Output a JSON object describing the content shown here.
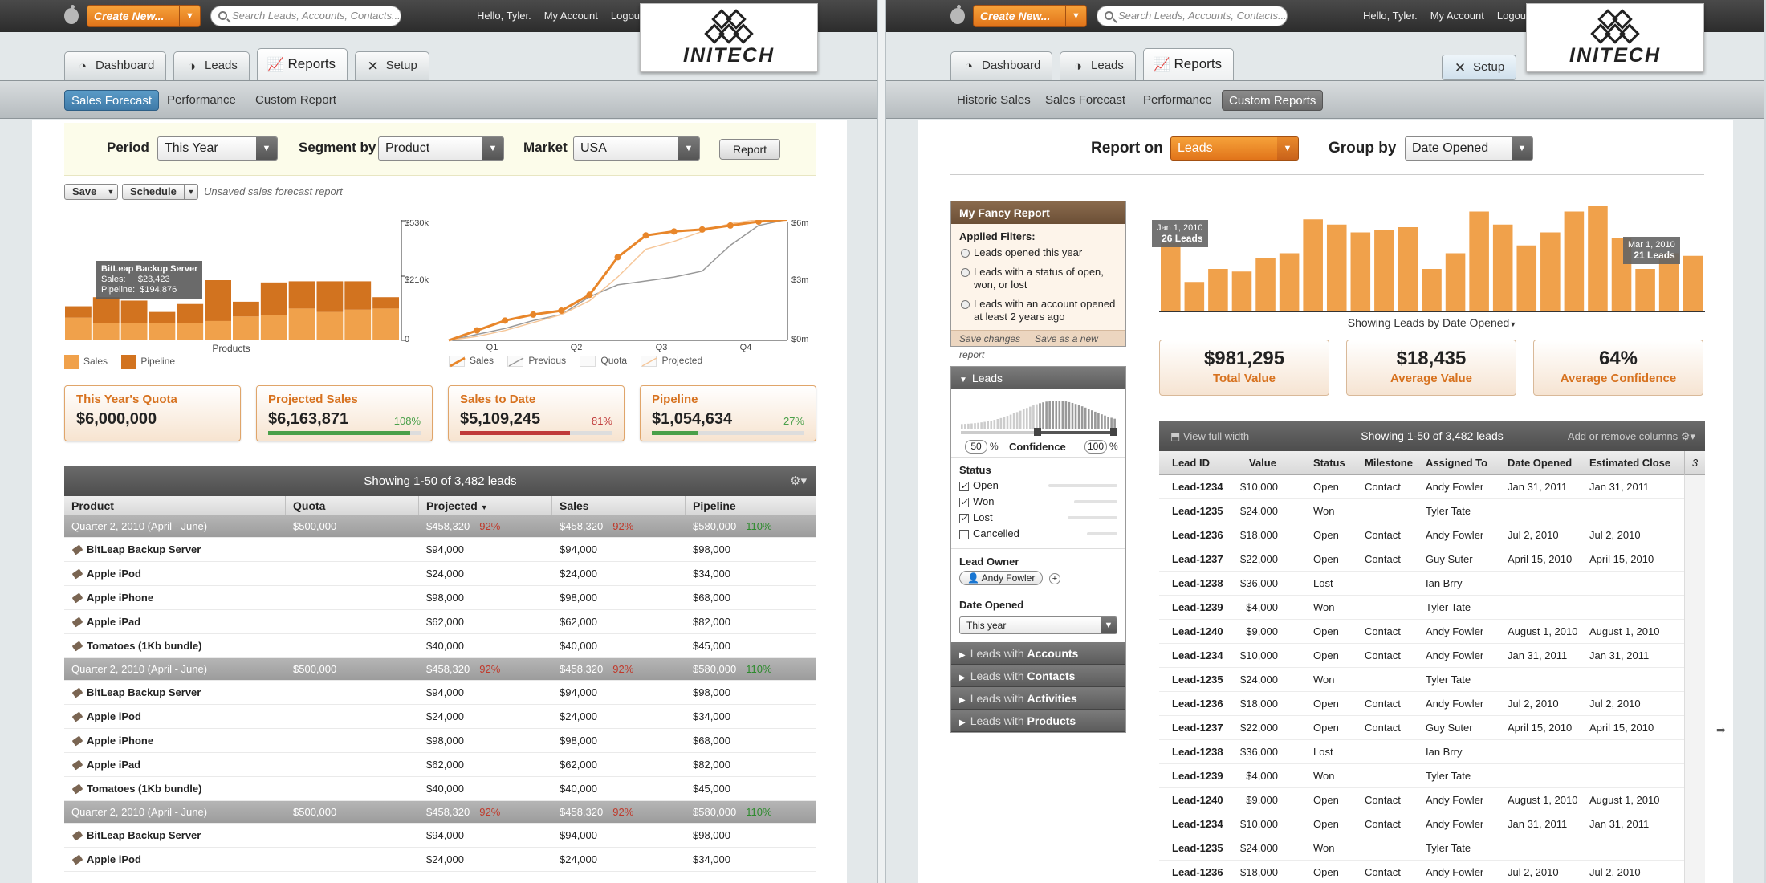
{
  "common": {
    "create_label": "Create New...",
    "search_placeholder": "Search Leads, Accounts, Contacts...",
    "greeting": "Hello, Tyler.",
    "my_account": "My Account",
    "logout": "Logout",
    "logo_text": "INITECH",
    "tabs": [
      "Dashboard",
      "Leads",
      "Reports",
      "Setup"
    ]
  },
  "left": {
    "subnav": [
      "Sales Forecast",
      "Performance",
      "Custom Report"
    ],
    "filters": {
      "period_label": "Period",
      "period_value": "This Year",
      "segment_label": "Segment by",
      "segment_value": "Product",
      "market_label": "Market",
      "market_value": "USA",
      "report_button": "Report"
    },
    "save_label": "Save",
    "schedule_label": "Schedule",
    "unsaved_note": "Unsaved sales forecast report",
    "bar_axis": [
      "$530k",
      "$210k",
      "0"
    ],
    "bar_xlabel": "Products",
    "tooltip": {
      "title": "BitLeap Backup Server",
      "sales": "Sales:     $23,423",
      "pipeline": "Pipeline:  $194,876"
    },
    "line_axis": [
      "$6m",
      "$3m",
      "$0m"
    ],
    "line_quarters": [
      "Q1",
      "Q2",
      "Q3",
      "Q4"
    ],
    "legend_bar": [
      "Sales",
      "Pipeline"
    ],
    "legend_line": [
      "Sales",
      "Previous",
      "Quota",
      "Projected"
    ],
    "cards": [
      {
        "title": "This Year's Quota",
        "value": "$6,000,000",
        "pct": "",
        "fill": 0,
        "color": ""
      },
      {
        "title": "Projected Sales",
        "value": "$6,163,871",
        "pct": "108%",
        "fill": 0.93,
        "color": "#4aa04a"
      },
      {
        "title": "Sales to Date",
        "value": "$5,109,245",
        "pct": "81%",
        "fill": 0.72,
        "color": "#c03a3a"
      },
      {
        "title": "Pipeline",
        "value": "$1,054,634",
        "pct": "27%",
        "fill": 0.3,
        "color": "#4aa04a"
      }
    ],
    "table_title": "Showing 1-50 of 3,482 leads",
    "columns": [
      "Product",
      "Quota",
      "Projected",
      "Sales",
      "Pipeline"
    ],
    "group": {
      "name": "Quarter 2, 2010 (April - June)",
      "quota": "$500,000",
      "projected": "$458,320",
      "projected_pct": "92%",
      "sales": "$458,320",
      "sales_pct": "92%",
      "pipeline": "$580,000",
      "pipeline_pct": "110%"
    },
    "products": [
      {
        "name": "BitLeap Backup Server",
        "projected": "$94,000",
        "sales": "$94,000",
        "pipeline": "$98,000"
      },
      {
        "name": "Apple iPod",
        "projected": "$24,000",
        "sales": "$24,000",
        "pipeline": "$34,000"
      },
      {
        "name": "Apple iPhone",
        "projected": "$98,000",
        "sales": "$98,000",
        "pipeline": "$68,000"
      },
      {
        "name": "Apple iPad",
        "projected": "$62,000",
        "sales": "$62,000",
        "pipeline": "$82,000"
      },
      {
        "name": "Tomatoes (1Kb bundle)",
        "projected": "$40,000",
        "sales": "$40,000",
        "pipeline": "$45,000"
      }
    ]
  },
  "right": {
    "subnav": [
      "Historic Sales",
      "Sales Forecast",
      "Performance",
      "Custom Reports"
    ],
    "report_on_label": "Report on",
    "report_on_value": "Leads",
    "group_by_label": "Group by",
    "group_by_value": "Date Opened",
    "saved": {
      "title": "My Fancy Report",
      "applied": "Applied Filters:",
      "filters": [
        "Leads opened this year",
        "Leads with a status of open, won, or lost",
        "Leads with an account opened at least 2 years ago"
      ],
      "save_changes": "Save changes",
      "save_new": "Save as a new report"
    },
    "leads_panel": {
      "title": "Leads",
      "conf_min": "50",
      "conf_max": "100",
      "conf_label": "Confidence",
      "pct": "%",
      "status_label": "Status",
      "statuses": [
        "Open",
        "Won",
        "Lost",
        "Cancelled"
      ],
      "owner_label": "Lead Owner",
      "owner": "Andy Fowler",
      "date_label": "Date Opened",
      "date_value": "This year"
    },
    "with_panels": [
      {
        "pre": "Leads with ",
        "name": "Accounts"
      },
      {
        "pre": "Leads with ",
        "name": "Contacts"
      },
      {
        "pre": "Leads with ",
        "name": "Activities"
      },
      {
        "pre": "Leads with ",
        "name": "Products"
      }
    ],
    "tip1": {
      "date": "Jan 1, 2010",
      "count": "26 Leads"
    },
    "tip2": {
      "date": "Mar 1, 2010",
      "count": "21 Leads"
    },
    "chart_caption": "Showing Leads by Date Opened",
    "kpis": [
      {
        "value": "$981,295",
        "label": "Total Value"
      },
      {
        "value": "$18,435",
        "label": "Average Value"
      },
      {
        "value": "64%",
        "label": "Average Confidence"
      }
    ],
    "table": {
      "view_full": "View full width",
      "title": "Showing 1-50 of 3,482 leads",
      "add_remove": "Add or remove columns",
      "col_count": "3"
    },
    "columns": [
      "Lead ID",
      "Value",
      "Status",
      "Milestone",
      "Assigned To",
      "Date Opened",
      "Estimated Close"
    ],
    "rows": [
      [
        "Lead-1234",
        "$10,000",
        "Open",
        "Contact",
        "Andy Fowler",
        "Jan 31, 2011",
        "Jan 31, 2011"
      ],
      [
        "Lead-1235",
        "$24,000",
        "Won",
        "",
        "Tyler Tate",
        "",
        ""
      ],
      [
        "Lead-1236",
        "$18,000",
        "Open",
        "Contact",
        "Andy Fowler",
        "Jul 2, 2010",
        "Jul 2, 2010"
      ],
      [
        "Lead-1237",
        "$22,000",
        "Open",
        "Contact",
        "Guy Suter",
        "April 15, 2010",
        "April 15, 2010"
      ],
      [
        "Lead-1238",
        "$36,000",
        "Lost",
        "",
        "Ian Brry",
        "",
        ""
      ],
      [
        "Lead-1239",
        "$4,000",
        "Won",
        "",
        "Tyler Tate",
        "",
        ""
      ],
      [
        "Lead-1240",
        "$9,000",
        "Open",
        "Contact",
        "Andy Fowler",
        "August 1, 2010",
        "August 1, 2010"
      ],
      [
        "Lead-1234",
        "$10,000",
        "Open",
        "Contact",
        "Andy Fowler",
        "Jan 31, 2011",
        "Jan 31, 2011"
      ],
      [
        "Lead-1235",
        "$24,000",
        "Won",
        "",
        "Tyler Tate",
        "",
        ""
      ],
      [
        "Lead-1236",
        "$18,000",
        "Open",
        "Contact",
        "Andy Fowler",
        "Jul 2, 2010",
        "Jul 2, 2010"
      ],
      [
        "Lead-1237",
        "$22,000",
        "Open",
        "Contact",
        "Guy Suter",
        "April 15, 2010",
        "April 15, 2010"
      ],
      [
        "Lead-1238",
        "$36,000",
        "Lost",
        "",
        "Ian Brry",
        "",
        ""
      ],
      [
        "Lead-1239",
        "$4,000",
        "Won",
        "",
        "Tyler Tate",
        "",
        ""
      ],
      [
        "Lead-1240",
        "$9,000",
        "Open",
        "Contact",
        "Andy Fowler",
        "August 1, 2010",
        "August 1, 2010"
      ],
      [
        "Lead-1234",
        "$10,000",
        "Open",
        "Contact",
        "Andy Fowler",
        "Jan 31, 2011",
        "Jan 31, 2011"
      ],
      [
        "Lead-1235",
        "$24,000",
        "Won",
        "",
        "Tyler Tate",
        "",
        ""
      ],
      [
        "Lead-1236",
        "$18,000",
        "Open",
        "Contact",
        "Andy Fowler",
        "Jul 2, 2010",
        "Jul 2, 2010"
      ]
    ]
  },
  "chart_data": [
    {
      "type": "bar",
      "title": "",
      "xlabel": "Products",
      "ylabel": "",
      "ylim": [
        0,
        530000
      ],
      "yticks": [
        "0",
        "$210k",
        "$530k"
      ],
      "series": [
        {
          "name": "Sales",
          "values": [
            200000,
            150000,
            150000,
            150000,
            150000,
            170000,
            210000,
            220000,
            280000,
            250000,
            270000,
            280000
          ]
        },
        {
          "name": "Pipeline",
          "values": [
            100000,
            230000,
            200000,
            100000,
            170000,
            360000,
            130000,
            290000,
            240000,
            270000,
            250000,
            100000
          ]
        }
      ]
    },
    {
      "type": "line",
      "title": "",
      "xlabel": "",
      "ylabel": "",
      "ylim": [
        0,
        6
      ],
      "yticks": [
        "$0m",
        "$3m",
        "$6m"
      ],
      "x": [
        "",
        "Q1",
        "",
        "",
        "Q2",
        "",
        "",
        "Q3",
        "",
        "",
        "Q4",
        "",
        ""
      ],
      "series": [
        {
          "name": "Sales",
          "values": [
            0,
            0.5,
            1.0,
            1.3,
            1.5,
            2.3,
            4.2,
            5.3,
            5.5,
            5.6,
            5.8,
            6.0,
            6.1
          ]
        },
        {
          "name": "Previous",
          "values": [
            0,
            0.3,
            0.6,
            1.0,
            1.3,
            2.2,
            2.8,
            3.0,
            3.2,
            3.5,
            4.8,
            5.8,
            6.1
          ]
        },
        {
          "name": "Projected",
          "values": [
            0,
            0.2,
            0.5,
            0.9,
            1.3,
            2.0,
            3.2,
            4.6,
            5.0,
            5.5,
            5.9,
            6.1,
            6.3
          ]
        }
      ]
    },
    {
      "type": "bar",
      "title": "",
      "xlabel": "Showing Leads by Date Opened",
      "ylabel": "",
      "ylim": [
        0,
        30
      ],
      "series": [
        {
          "name": "Leads",
          "values": [
            26,
            11,
            16,
            15,
            20,
            22,
            35,
            33,
            30,
            31,
            32,
            16,
            22,
            38,
            33,
            25,
            30,
            38,
            40,
            28,
            16,
            22,
            21
          ]
        }
      ]
    }
  ]
}
